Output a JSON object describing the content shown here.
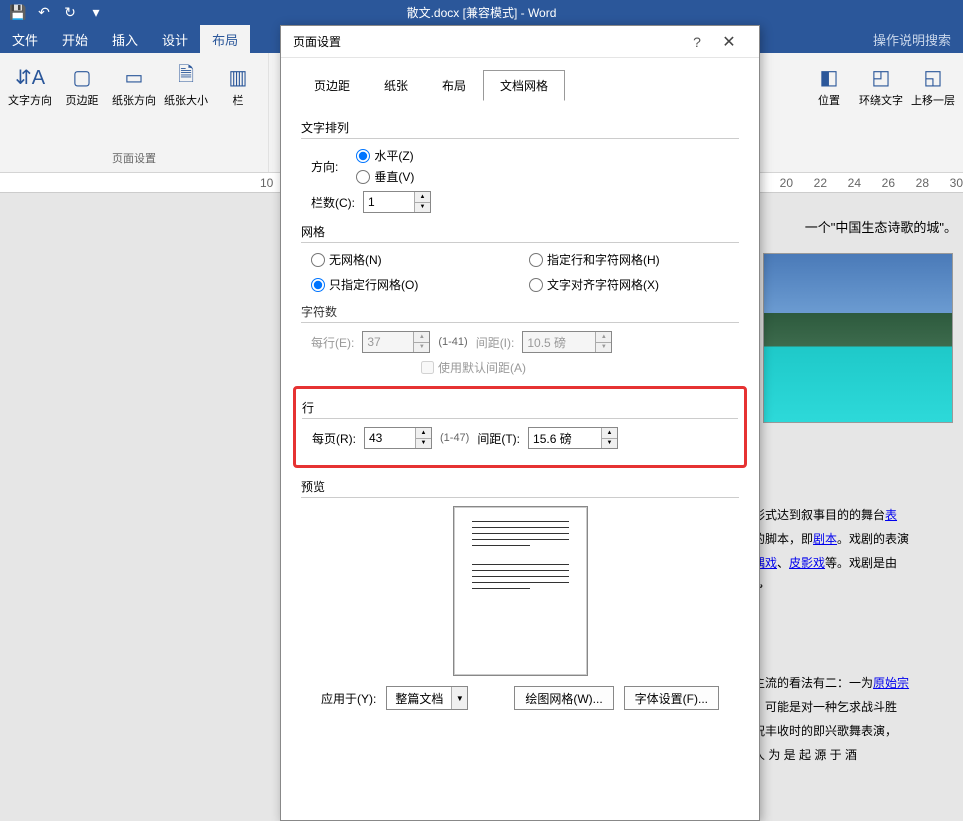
{
  "titlebar": {
    "doc_title": "散文.docx [兼容模式] - Word"
  },
  "menu": {
    "file": "文件",
    "home": "开始",
    "insert": "插入",
    "design": "设计",
    "layout": "布局",
    "tell": "操作说明搜索"
  },
  "ribbon": {
    "group1": {
      "text_dir": "文字方向",
      "margins": "页边距",
      "orient": "纸张方向",
      "size": "纸张大小",
      "cols": "栏",
      "label": "页面设置"
    },
    "group2": {
      "pos": "位置",
      "wrap": "环绕文字",
      "forward": "上移一层"
    }
  },
  "ruler": {
    "marks": [
      "10",
      "20",
      "22",
      "24",
      "26",
      "28",
      "30"
    ]
  },
  "doc": {
    "line0": "一个\"中国生态诗歌的城\"。",
    "line1": "形式达到叙事目的的舞台",
    "link1": "表",
    "line2a": "的脚本，即",
    "link2": "剧本",
    "line2b": "。戏剧的表演",
    "link3a": "偶戏",
    "sep": "、",
    "link3b": "皮影戏",
    "line3": "等。戏剧是由",
    "line4": "主流的看法有二：一为",
    "link4": "原始宗",
    "line5": "，可能是对一种乞求战斗胜",
    "line6": "祝丰收时的即兴歌舞表演，",
    "line7": "人  为  是  起  源  于  酒"
  },
  "dialog": {
    "title": "页面设置",
    "tabs": {
      "margins": "页边距",
      "paper": "纸张",
      "layout": "布局",
      "grid": "文档网格"
    },
    "text_arrange": {
      "legend": "文字排列",
      "direction": "方向:",
      "horiz": "水平(Z)",
      "vert": "垂直(V)",
      "cols": "栏数(C):",
      "cols_val": "1"
    },
    "grid": {
      "legend": "网格",
      "none": "无网格(N)",
      "row_only": "只指定行网格(O)",
      "row_char": "指定行和字符网格(H)",
      "align": "文字对齐字符网格(X)"
    },
    "chars": {
      "legend": "字符数",
      "per_line": "每行(E):",
      "per_line_val": "37",
      "per_line_range": "(1-41)",
      "spacing": "间距(I):",
      "spacing_val": "10.5 磅",
      "use_default": "使用默认间距(A)"
    },
    "lines": {
      "legend": "行",
      "per_page": "每页(R):",
      "per_page_val": "43",
      "per_page_range": "(1-47)",
      "spacing": "间距(T):",
      "spacing_val": "15.6 磅"
    },
    "preview": "预览",
    "footer": {
      "apply_to": "应用于(Y):",
      "apply_val": "整篇文档",
      "draw_grid": "绘图网格(W)...",
      "font_set": "字体设置(F)..."
    }
  }
}
